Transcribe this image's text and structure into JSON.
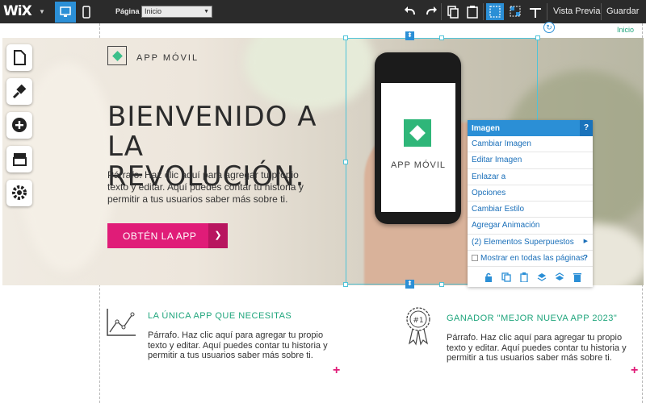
{
  "topbar": {
    "logo": "WiX",
    "page_label": "Página",
    "page_selected": "Inicio",
    "preview_label": "Vista Previa",
    "save_label": "Guardar"
  },
  "ruler": {
    "page_tag": "Inicio"
  },
  "hero": {
    "brand": "APP MÓVIL",
    "title": "BIENVENIDO A LA REVOLUCIÓN.",
    "paragraph": "Párrafo. Haz clic aquí para agregar tu propio texto y editar. Aquí puedes contar tu historia y permitir a tus usuarios saber más sobre ti.",
    "cta_label": "OBTÉN LA APP",
    "phone_text": "APP MÓVIL"
  },
  "panel": {
    "title": "Imagen",
    "help": "?",
    "items": [
      "Cambiar Imagen",
      "Editar Imagen",
      "Enlazar a",
      "Opciones",
      "Cambiar Estilo",
      "Agregar Animación",
      "(2) Elementos Superpuestos",
      "Mostrar en todas las páginas"
    ]
  },
  "features": [
    {
      "title": "LA ÚNICA APP QUE NECESITAS",
      "text": "Párrafo. Haz clic aquí para agregar tu propio texto y editar. Aquí puedes contar tu historia y permitir a tus usuarios saber más sobre ti."
    },
    {
      "title": "GANADOR \"MEJOR NUEVA APP 2023\"",
      "text": "Párrafo. Haz clic aquí para agregar tu propio texto y editar. Aquí puedes contar tu historia y permitir a tus usuarios saber más sobre ti.",
      "badge": "#1"
    }
  ],
  "colors": {
    "accent": "#2b8fd6",
    "brand_green": "#1fa57c",
    "cta_pink": "#e01c78"
  },
  "icons": [
    "page-icon",
    "brush-icon",
    "add-icon",
    "store-icon",
    "settings-icon"
  ]
}
